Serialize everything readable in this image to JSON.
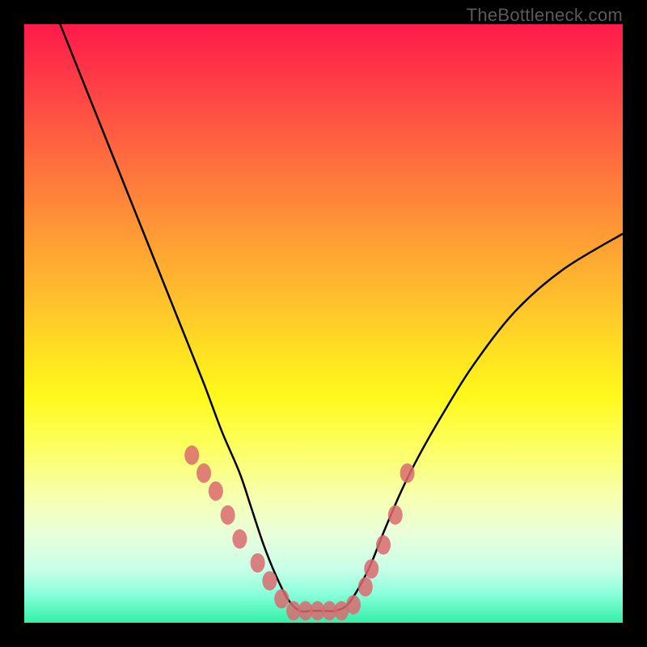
{
  "watermark": "TheBottleneck.com",
  "colors": {
    "background_frame": "#000000",
    "curve": "#000000",
    "marker": "#da6a6e",
    "gradient_top": "#ff1a4a",
    "gradient_bottom": "#32f0a8"
  },
  "chart_data": {
    "type": "line",
    "title": "",
    "xlabel": "",
    "ylabel": "",
    "xlim": [
      0,
      100
    ],
    "ylim": [
      0,
      100
    ],
    "note": "Axes have no tick labels; x and y values are normalized 0–100 estimated from pixel positions. y=0 is bottom. Single black curve shaped like a steep V with a flat floor near y≈2 around x≈45–53, climbing to y≈100 at the left edge and y≈65 at the right edge.",
    "series": [
      {
        "name": "bottleneck-curve",
        "x": [
          6,
          10,
          14,
          18,
          22,
          26,
          30,
          33,
          36,
          38,
          40,
          42,
          44,
          46,
          48,
          50,
          52,
          54,
          56,
          58,
          60,
          63,
          66,
          70,
          75,
          82,
          90,
          100
        ],
        "y": [
          100,
          90,
          80,
          70,
          60,
          50,
          40,
          32,
          25,
          19,
          13,
          8,
          4,
          2,
          2,
          2,
          2,
          3,
          6,
          10,
          15,
          22,
          28,
          35,
          43,
          52,
          59,
          65
        ]
      }
    ],
    "markers": {
      "name": "highlighted-points",
      "x": [
        28,
        30,
        32,
        34,
        36,
        39,
        41,
        43,
        45,
        47,
        49,
        51,
        53,
        55,
        57,
        58,
        60,
        62,
        64
      ],
      "y": [
        28,
        25,
        22,
        18,
        14,
        10,
        7,
        4,
        2,
        2,
        2,
        2,
        2,
        3,
        6,
        9,
        13,
        18,
        25
      ]
    }
  }
}
